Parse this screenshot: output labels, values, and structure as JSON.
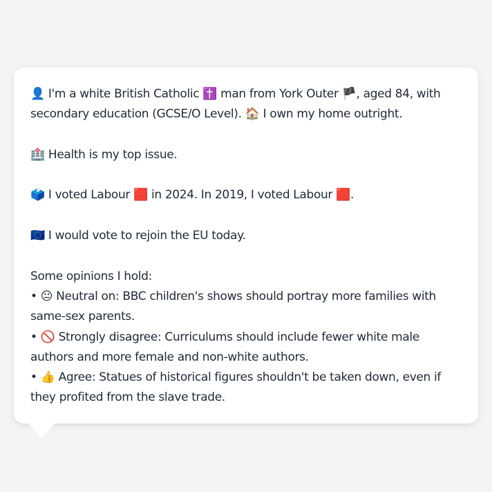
{
  "persona": {
    "intro": {
      "icon": "👤",
      "text_1": " I'm a white British Catholic ",
      "religion_icon": "✝️",
      "text_2": " man from York Outer ",
      "flag_icon": "🏴",
      "text_3": ", aged 84, with secondary education (GCSE/O Level). ",
      "home_icon": "🏠",
      "text_4": " I own my home outright."
    },
    "issue": {
      "icon": "🏥",
      "text": " Health is my top issue."
    },
    "vote": {
      "icon": "🗳️",
      "text_1": " I voted Labour ",
      "party_icon_1": "🟥",
      "text_2": " in 2024. In 2019, I voted Labour ",
      "party_icon_2": "🟥",
      "text_3": "."
    },
    "eu": {
      "icon": "🇪🇺",
      "text": " I would vote to rejoin the EU today."
    },
    "opinions_heading": "Some opinions I hold:",
    "opinions": [
      {
        "bullet": "• ",
        "icon": "😐",
        "text": " Neutral on: BBC children's shows should portray more families with same-sex parents."
      },
      {
        "bullet": "• ",
        "icon": "🚫",
        "text": " Strongly disagree: Curriculums should include fewer white male authors and more female and non-white authors."
      },
      {
        "bullet": "• ",
        "icon": "👍",
        "text": " Agree: Statues of historical figures shouldn't be taken down, even if they profited from the slave trade."
      }
    ]
  }
}
